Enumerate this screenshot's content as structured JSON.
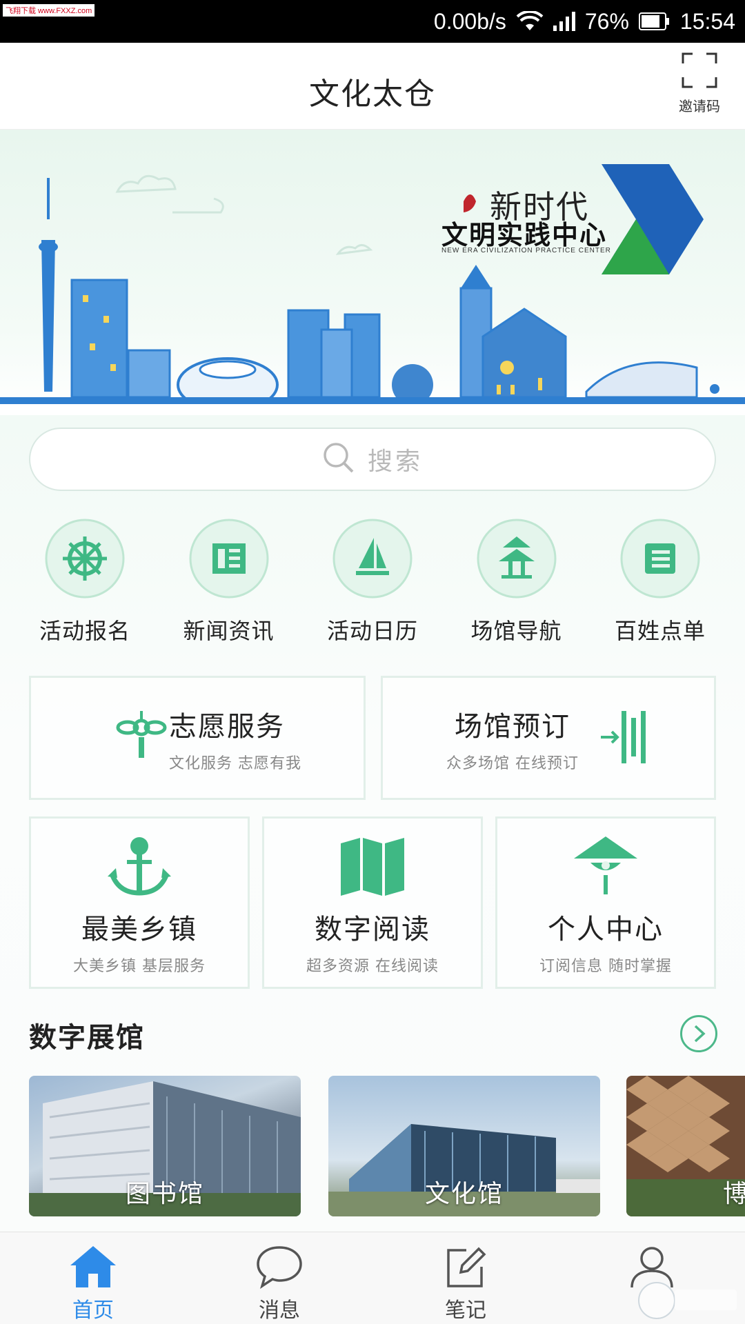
{
  "status_bar": {
    "watermark": "飞翔下载 www.FXXZ.com",
    "net_speed": "0.00b/s",
    "battery": "76%",
    "time": "15:54"
  },
  "header": {
    "title": "文化太仓",
    "invite_label": "邀请码"
  },
  "banner": {
    "line1": "新时代",
    "line2": "文明实践中心",
    "line3": "NEW ERA CIVILIZATION PRACTICE CENTER"
  },
  "search": {
    "placeholder": "搜索"
  },
  "quick_menu": [
    {
      "label": "活动报名",
      "icon": "helm-wheel-icon"
    },
    {
      "label": "新闻资讯",
      "icon": "newspaper-icon"
    },
    {
      "label": "活动日历",
      "icon": "sailboat-icon"
    },
    {
      "label": "场馆导航",
      "icon": "pagoda-icon"
    },
    {
      "label": "百姓点单",
      "icon": "menu-list-icon"
    }
  ],
  "cards": {
    "volunteer": {
      "title": "志愿服务",
      "subtitle": "文化服务 志愿有我"
    },
    "venue_booking": {
      "title": "场馆预订",
      "subtitle": "众多场馆 在线预订"
    },
    "towns": {
      "title": "最美乡镇",
      "subtitle": "大美乡镇 基层服务"
    },
    "reading": {
      "title": "数字阅读",
      "subtitle": "超多资源 在线阅读"
    },
    "personal": {
      "title": "个人中心",
      "subtitle": "订阅信息 随时掌握"
    }
  },
  "digital_hall": {
    "title": "数字展馆",
    "items": [
      {
        "label": "图书馆"
      },
      {
        "label": "文化馆"
      },
      {
        "label": "博"
      }
    ]
  },
  "tabs": [
    {
      "label": "首页",
      "icon": "home-icon",
      "active": true
    },
    {
      "label": "消息",
      "icon": "message-icon",
      "active": false
    },
    {
      "label": "笔记",
      "icon": "note-icon",
      "active": false
    },
    {
      "label": "",
      "icon": "profile-icon",
      "active": false
    }
  ],
  "colors": {
    "accent_green": "#3fb884",
    "tab_active": "#2e8be8",
    "banner_blue": "#2f7fd0"
  }
}
